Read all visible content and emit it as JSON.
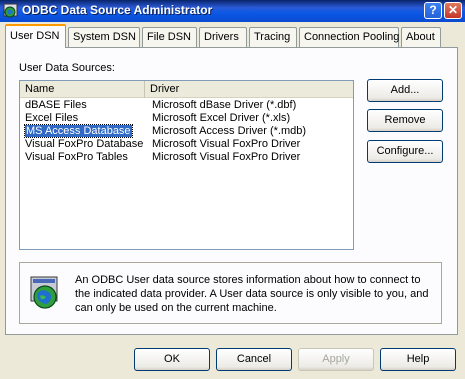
{
  "window": {
    "title": "ODBC Data Source Administrator",
    "help_glyph": "?",
    "close_glyph": "✕"
  },
  "tabs": [
    {
      "label": "User DSN",
      "active": true
    },
    {
      "label": "System DSN",
      "active": false
    },
    {
      "label": "File DSN",
      "active": false
    },
    {
      "label": "Drivers",
      "active": false
    },
    {
      "label": "Tracing",
      "active": false
    },
    {
      "label": "Connection Pooling",
      "active": false
    },
    {
      "label": "About",
      "active": false
    }
  ],
  "user_dsn": {
    "list_label": "User Data Sources:",
    "columns": [
      "Name",
      "Driver"
    ],
    "rows": [
      {
        "name": "dBASE Files",
        "driver": "Microsoft dBase Driver (*.dbf)",
        "selected": false
      },
      {
        "name": "Excel Files",
        "driver": "Microsoft Excel Driver (*.xls)",
        "selected": false
      },
      {
        "name": "MS Access Database",
        "driver": "Microsoft Access Driver (*.mdb)",
        "selected": true
      },
      {
        "name": "Visual FoxPro Database",
        "driver": "Microsoft Visual FoxPro Driver",
        "selected": false
      },
      {
        "name": "Visual FoxPro Tables",
        "driver": "Microsoft Visual FoxPro Driver",
        "selected": false
      }
    ],
    "buttons": {
      "add": "Add...",
      "remove": "Remove",
      "configure": "Configure..."
    },
    "info_text": "An ODBC User data source stores information about how to connect to the indicated data provider.   A User data source is only visible to you, and can only be used on the current machine."
  },
  "footer": {
    "ok": "OK",
    "cancel": "Cancel",
    "apply": "Apply",
    "help": "Help"
  },
  "icons": {
    "title": "odbc-globe-icon",
    "info": "odbc-globe-icon"
  }
}
